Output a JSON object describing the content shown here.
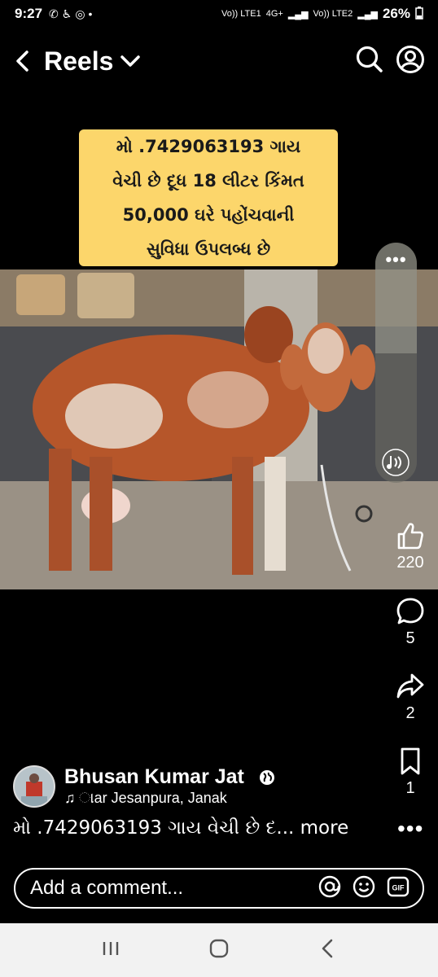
{
  "status_bar": {
    "time": "9:27",
    "icons": [
      "missed-call-icon",
      "accessibility-icon",
      "whatsapp-icon",
      "dot"
    ],
    "network_left": "Vo)) LTE1",
    "network_mid": "4G+",
    "network_right": "Vo)) LTE2",
    "battery": "26%"
  },
  "header": {
    "title": "Reels"
  },
  "video": {
    "caption_lines": [
      "મો .7429063193 ગાય",
      "વેચી છે દૂધ 18 લીટર કિંમત",
      "50,000 ઘરે પહોંચવાની",
      "સુવિધા ઉપલબ્ધ છે"
    ]
  },
  "actions": {
    "likes": "220",
    "comments": "5",
    "shares": "2",
    "saves": "1"
  },
  "author": {
    "name": "Bhusan Kumar Jat",
    "music": "ાar Jesanpura, Janak"
  },
  "post": {
    "caption": "મો .7429063193 ગાય વેચી છે દ...",
    "more_label": "more"
  },
  "comment": {
    "placeholder": "Add a comment..."
  },
  "colors": {
    "background": "#000000",
    "caption_bg": "#fcd66b",
    "nav_bg": "#f2f2f2"
  }
}
